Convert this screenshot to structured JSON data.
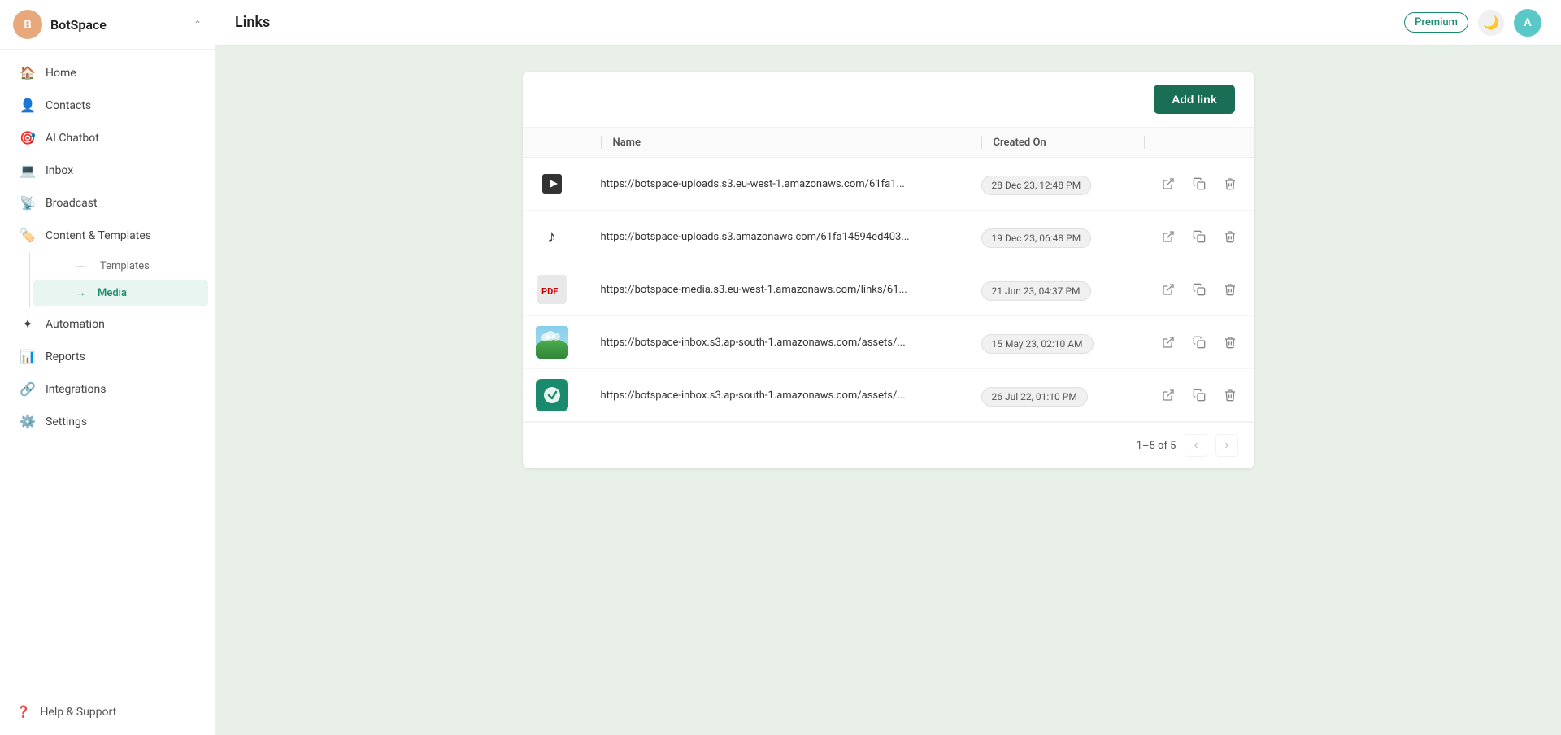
{
  "sidebar": {
    "brand": "BotSpace",
    "brand_initial": "B",
    "nav_items": [
      {
        "id": "home",
        "label": "Home",
        "icon": "🏠"
      },
      {
        "id": "contacts",
        "label": "Contacts",
        "icon": "👤"
      },
      {
        "id": "ai-chatbot",
        "label": "AI Chatbot",
        "icon": "🎯"
      },
      {
        "id": "inbox",
        "label": "Inbox",
        "icon": "💻"
      },
      {
        "id": "broadcast",
        "label": "Broadcast",
        "icon": "📡"
      },
      {
        "id": "content-templates",
        "label": "Content & Templates",
        "icon": "🏷️"
      },
      {
        "id": "automation",
        "label": "Automation",
        "icon": "✦"
      },
      {
        "id": "reports",
        "label": "Reports",
        "icon": "📊"
      },
      {
        "id": "integrations",
        "label": "Integrations",
        "icon": "🔗"
      },
      {
        "id": "settings",
        "label": "Settings",
        "icon": "⚙️"
      }
    ],
    "sub_items": [
      {
        "id": "templates",
        "label": "Templates"
      },
      {
        "id": "media",
        "label": "Media"
      }
    ],
    "help_label": "Help & Support"
  },
  "topbar": {
    "title": "Links",
    "premium_label": "Premium",
    "user_initial": "A"
  },
  "table": {
    "columns": [
      {
        "id": "icon",
        "label": ""
      },
      {
        "id": "name",
        "label": "Name"
      },
      {
        "id": "created_on",
        "label": "Created On"
      },
      {
        "id": "actions",
        "label": ""
      }
    ],
    "rows": [
      {
        "type": "video",
        "icon": "🎬",
        "url": "https://botspace-uploads.s3.eu-west-1.amazonaws.com/61fa1...",
        "date": "28 Dec 23, 12:48 PM"
      },
      {
        "type": "audio",
        "icon": "♪",
        "url": "https://botspace-uploads.s3.amazonaws.com/61fa14594ed403...",
        "date": "19 Dec 23, 06:48 PM"
      },
      {
        "type": "pdf",
        "icon": "📄",
        "url": "https://botspace-media.s3.eu-west-1.amazonaws.com/links/61...",
        "date": "21 Jun 23, 04:37 PM"
      },
      {
        "type": "image-landscape",
        "icon": "🖼",
        "url": "https://botspace-inbox.s3.ap-south-1.amazonaws.com/assets/...",
        "date": "15 May 23, 02:10 AM"
      },
      {
        "type": "image-green",
        "icon": "🟢",
        "url": "https://botspace-inbox.s3.ap-south-1.amazonaws.com/assets/...",
        "date": "26 Jul 22, 01:10 PM"
      }
    ],
    "pagination": {
      "label": "1–5 of 5"
    }
  },
  "buttons": {
    "add_link": "Add link"
  }
}
